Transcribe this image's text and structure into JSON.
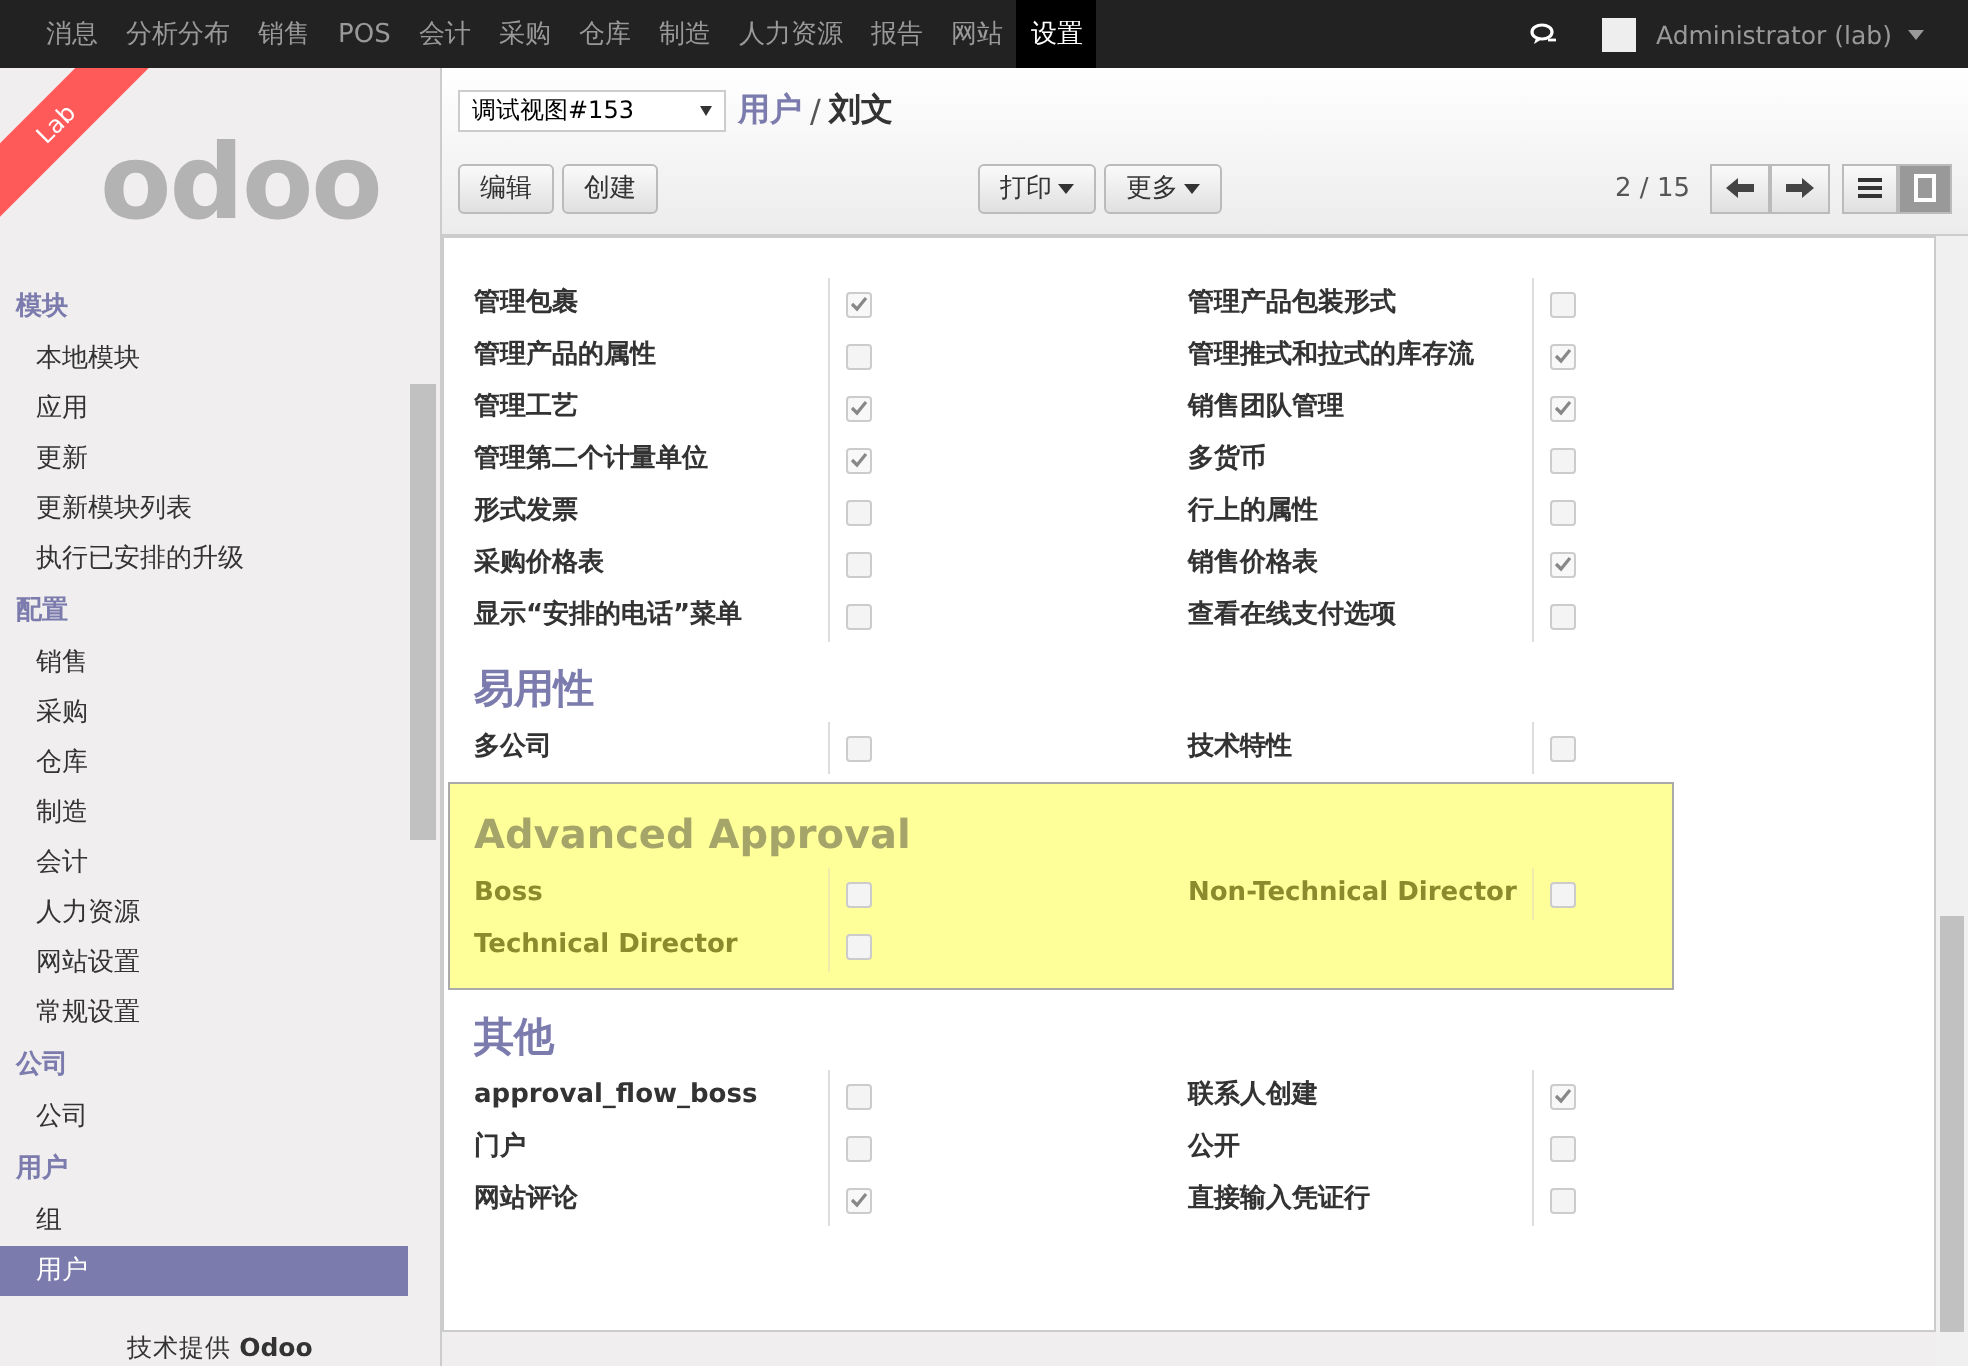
{
  "top_menu": [
    {
      "label": "消息",
      "selected": false
    },
    {
      "label": "分析分布",
      "selected": false
    },
    {
      "label": "销售",
      "selected": false
    },
    {
      "label": "POS",
      "selected": false
    },
    {
      "label": "会计",
      "selected": false
    },
    {
      "label": "采购",
      "selected": false
    },
    {
      "label": "仓库",
      "selected": false
    },
    {
      "label": "制造",
      "selected": false
    },
    {
      "label": "人力资源",
      "selected": false
    },
    {
      "label": "报告",
      "selected": false
    },
    {
      "label": "网站",
      "selected": false
    },
    {
      "label": "设置",
      "selected": true
    }
  ],
  "user": {
    "name": "Administrator (lab)"
  },
  "logo": {
    "text": "odoo",
    "ribbon": "Lab"
  },
  "sidebar": [
    {
      "heading": "模块",
      "items": [
        {
          "label": "本地模块",
          "selected": false
        },
        {
          "label": "应用",
          "selected": false
        },
        {
          "label": "更新",
          "selected": false
        },
        {
          "label": "更新模块列表",
          "selected": false
        },
        {
          "label": "执行已安排的升级",
          "selected": false
        }
      ]
    },
    {
      "heading": "配置",
      "items": [
        {
          "label": "销售",
          "selected": false
        },
        {
          "label": "采购",
          "selected": false
        },
        {
          "label": "仓库",
          "selected": false
        },
        {
          "label": "制造",
          "selected": false
        },
        {
          "label": "会计",
          "selected": false
        },
        {
          "label": "人力资源",
          "selected": false
        },
        {
          "label": "网站设置",
          "selected": false
        },
        {
          "label": "常规设置",
          "selected": false
        }
      ]
    },
    {
      "heading": "公司",
      "items": [
        {
          "label": "公司",
          "selected": false
        }
      ]
    },
    {
      "heading": "用户",
      "items": [
        {
          "label": "组",
          "selected": false
        },
        {
          "label": "用户",
          "selected": true
        }
      ]
    }
  ],
  "footer": "技术提供 **Odoo**",
  "view_select": "调试视图#153",
  "breadcrumb": {
    "parent": "用户",
    "separator": "/",
    "current": "刘文"
  },
  "buttons": [
    "编辑",
    "创建"
  ],
  "menus": [
    "打印",
    "更多"
  ],
  "pager": "2 / 15",
  "view_modes": [
    {
      "kind": "list",
      "selected": false
    },
    {
      "kind": "form",
      "selected": true
    }
  ],
  "sections": [
    {
      "highlighted": false,
      "fields": [
        {
          "label": "管理包裹",
          "checked": true
        },
        {
          "label": "管理产品包装形式",
          "checked": false
        },
        {
          "label": "管理产品的属性",
          "checked": false
        },
        {
          "label": "管理推式和拉式的库存流",
          "checked": true
        },
        {
          "label": "管理工艺",
          "checked": true
        },
        {
          "label": "销售团队管理",
          "checked": true
        },
        {
          "label": "管理第二个计量单位",
          "checked": true
        },
        {
          "label": "多货币",
          "checked": false
        },
        {
          "label": "形式发票",
          "checked": false
        },
        {
          "label": "行上的属性",
          "checked": false
        },
        {
          "label": "采购价格表",
          "checked": false
        },
        {
          "label": "销售价格表",
          "checked": true
        },
        {
          "label": "显示“安排的电话”菜单",
          "checked": false
        },
        {
          "label": "查看在线支付选项",
          "checked": false
        }
      ]
    },
    {
      "title": "易用性",
      "highlighted": false,
      "fields": [
        {
          "label": "多公司",
          "checked": false
        },
        {
          "label": "技术特性",
          "checked": false
        }
      ]
    },
    {
      "title": "Advanced Approval",
      "highlighted": true,
      "fields": [
        {
          "label": "Boss",
          "checked": false
        },
        {
          "label": "Non-Technical Director",
          "checked": false
        },
        {
          "label": "Technical Director",
          "checked": false
        }
      ]
    },
    {
      "title": "其他",
      "highlighted": false,
      "fields": [
        {
          "label": "approval_flow_boss",
          "checked": false
        },
        {
          "label": "联系人创建",
          "checked": true
        },
        {
          "label": "门户",
          "checked": false
        },
        {
          "label": "公开",
          "checked": false
        },
        {
          "label": "网站评论",
          "checked": true
        },
        {
          "label": "直接输入凭证行",
          "checked": false
        }
      ]
    }
  ]
}
